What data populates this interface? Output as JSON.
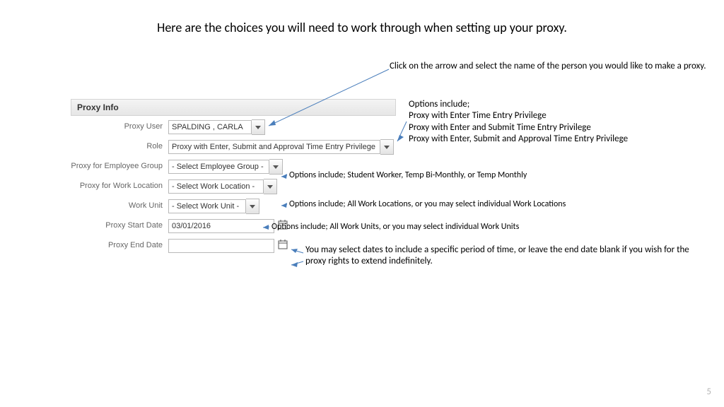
{
  "title": "Here are the choices you will need to work through when setting up your proxy.",
  "panel": {
    "header": "Proxy Info",
    "proxy_user": {
      "label": "Proxy User",
      "value": "SPALDING , CARLA"
    },
    "role": {
      "label": "Role",
      "value": "Proxy with Enter, Submit and Approval Time Entry Privilege"
    },
    "employee_group": {
      "label": "Proxy for Employee Group",
      "value": "- Select Employee Group -"
    },
    "work_location": {
      "label": "Proxy for Work Location",
      "value": "- Select Work Location -"
    },
    "work_unit": {
      "label": "Work Unit",
      "value": "- Select Work Unit -"
    },
    "start_date": {
      "label": "Proxy Start Date",
      "value": "03/01/2016"
    },
    "end_date": {
      "label": "Proxy End Date",
      "value": ""
    }
  },
  "annotations": {
    "top": "Click on the arrow and select the name of the person you would like to make a proxy.",
    "role_opts": {
      "intro": "Options include;",
      "l1": "Proxy with Enter Time Entry Privilege",
      "l2": "Proxy with Enter and Submit Time Entry Privilege",
      "l3": "Proxy with Enter, Submit and Approval Time Entry Privilege"
    },
    "emp_group": "Options include;  Student Worker, Temp Bi-Monthly, or Temp Monthly",
    "work_loc": "Options include;  All Work Locations, or you may select individual Work Locations",
    "work_unit": "Options include;  All Work Units, or you may select individual Work Units",
    "dates": "You may select dates to include a specific period of time, or leave the end date blank if you wish for the proxy rights to extend indefinitely."
  },
  "page_number": "5"
}
